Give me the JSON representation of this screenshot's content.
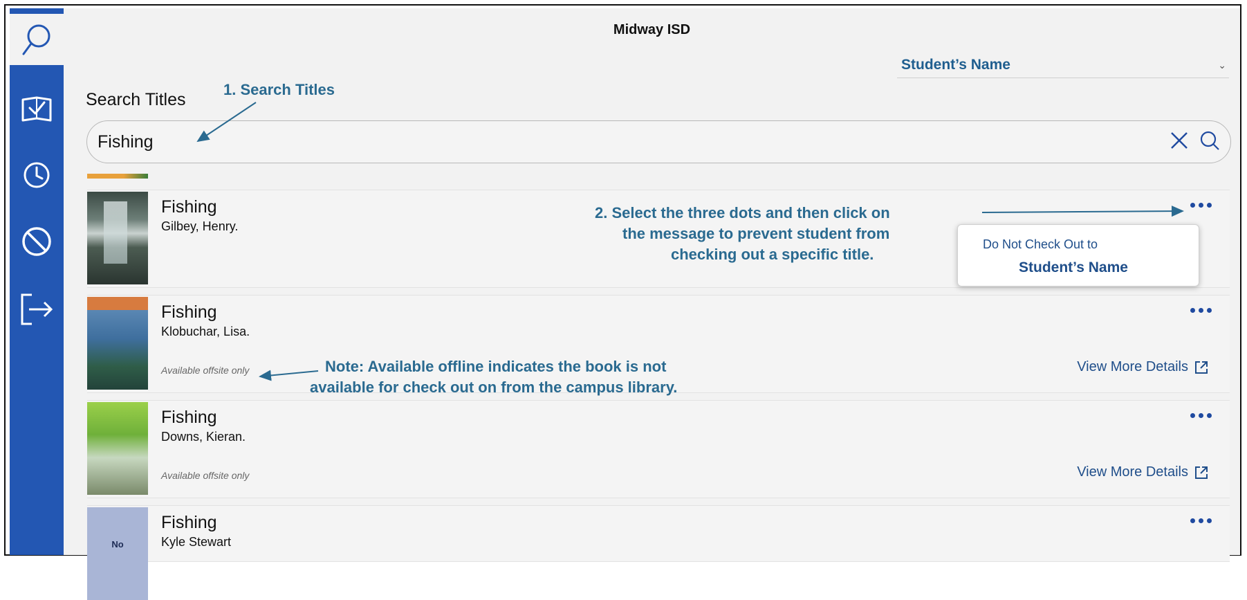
{
  "app": {
    "title": "Midway ISD"
  },
  "student_select": {
    "value": "Student’s Name"
  },
  "search": {
    "heading": "Search Titles",
    "value": "Fishing"
  },
  "sidebar": {
    "items": [
      {
        "icon": "search-icon",
        "active": true
      },
      {
        "icon": "book-check-icon"
      },
      {
        "icon": "clock-icon"
      },
      {
        "icon": "block-icon"
      },
      {
        "icon": "logout-icon"
      }
    ]
  },
  "results": [
    {
      "title": "Fishing",
      "author": "Gilbey, Henry.",
      "availability": "",
      "details_label": ""
    },
    {
      "title": "Fishing",
      "author": "Klobuchar, Lisa.",
      "availability": "Available offsite only",
      "details_label": "View More Details"
    },
    {
      "title": "Fishing",
      "author": "Downs, Kieran.",
      "availability": "Available offsite only",
      "details_label": "View More Details"
    },
    {
      "title": "Fishing",
      "author": "Kyle Stewart",
      "availability": "",
      "details_label": "",
      "cover_text": "No"
    }
  ],
  "popup": {
    "line1": "Do Not Check Out to",
    "line2": "Student’s Name"
  },
  "annotations": {
    "step1": "1. Search Titles",
    "step2_line1": "2. Select the three dots and then click on",
    "step2_line2": "the message to prevent student from",
    "step2_line3": "checking out a specific title.",
    "note_line1": "Note: Available offline indicates the book is not",
    "note_line2": "available for check out on from the campus library."
  },
  "colors": {
    "sidebar": "#2357b3",
    "accent_text": "#1f4e8a",
    "annotation": "#2a6a90"
  }
}
